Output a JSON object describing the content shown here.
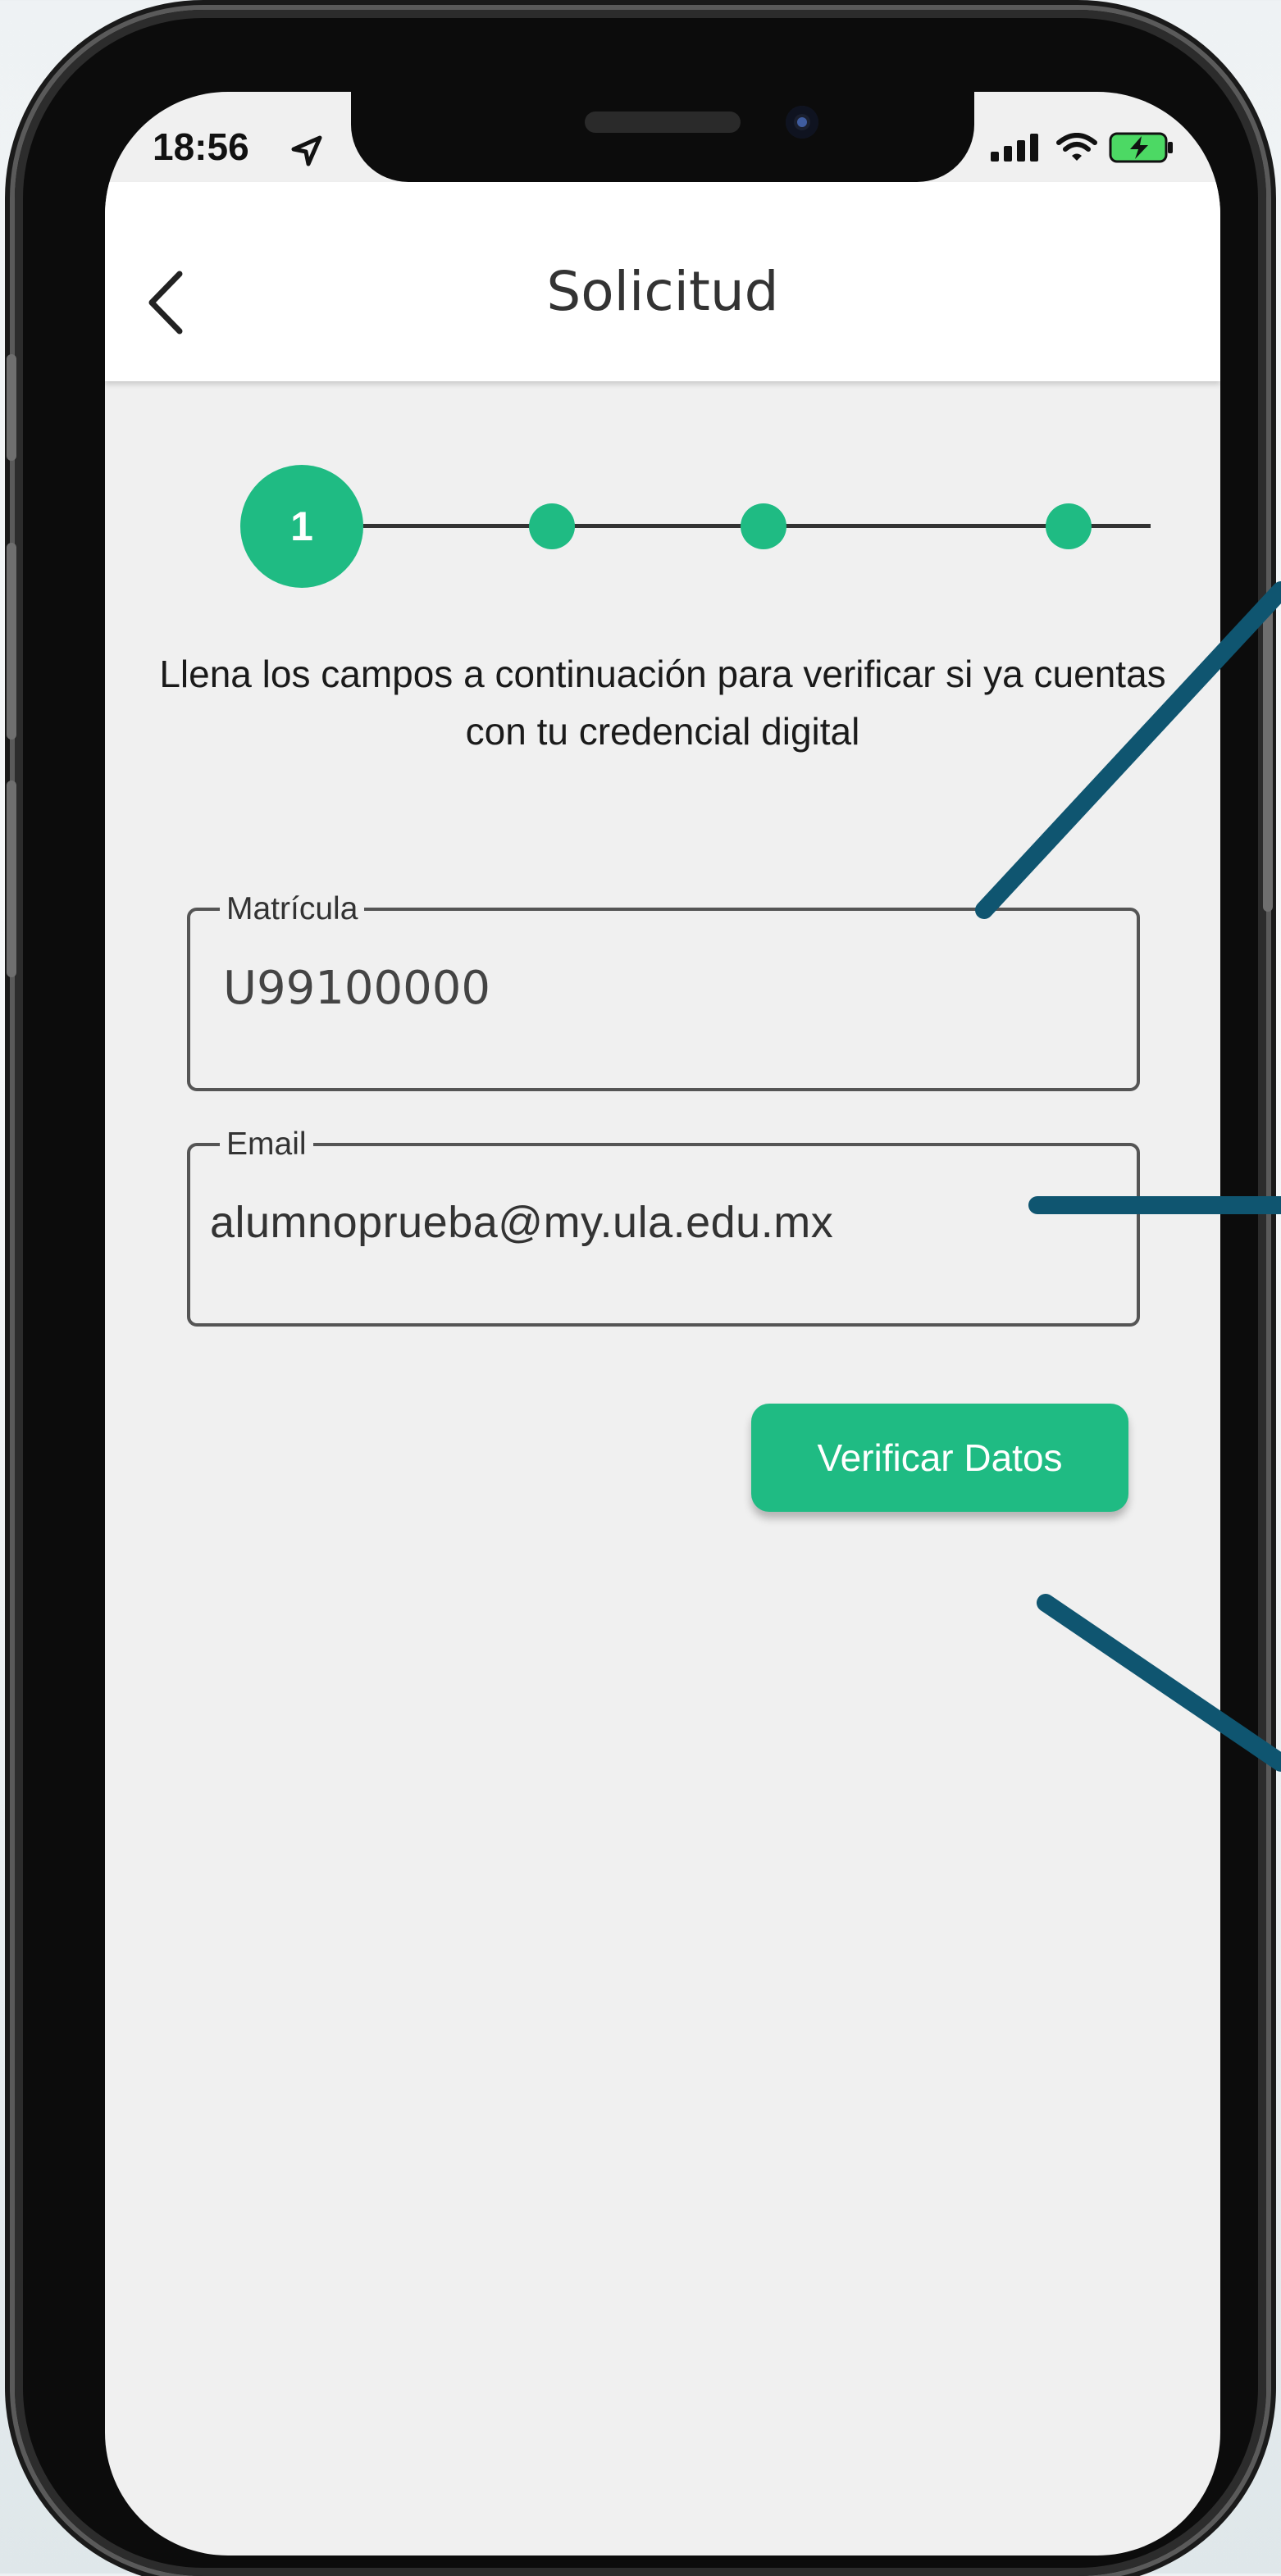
{
  "status_bar": {
    "time": "18:56",
    "icons": [
      "location-arrow-icon",
      "signal-icon",
      "wifi-icon",
      "battery-charging-icon"
    ]
  },
  "header": {
    "title": "Solicitud",
    "back_icon": "chevron-left-icon"
  },
  "stepper": {
    "current_step": "1",
    "total_steps": 4
  },
  "instructions": "Llena los campos a continuación para verificar si ya cuentas con tu credencial digital",
  "form": {
    "matricula": {
      "label": "Matrícula",
      "value": "U99100000"
    },
    "email": {
      "label": "Email",
      "value": "alumnoprueba@my.ula.edu.mx"
    }
  },
  "actions": {
    "verify_label": "Verificar Datos"
  },
  "colors": {
    "accent": "#1fbb83",
    "pointer": "#0f5570",
    "screen_bg": "#f0f0f0"
  }
}
